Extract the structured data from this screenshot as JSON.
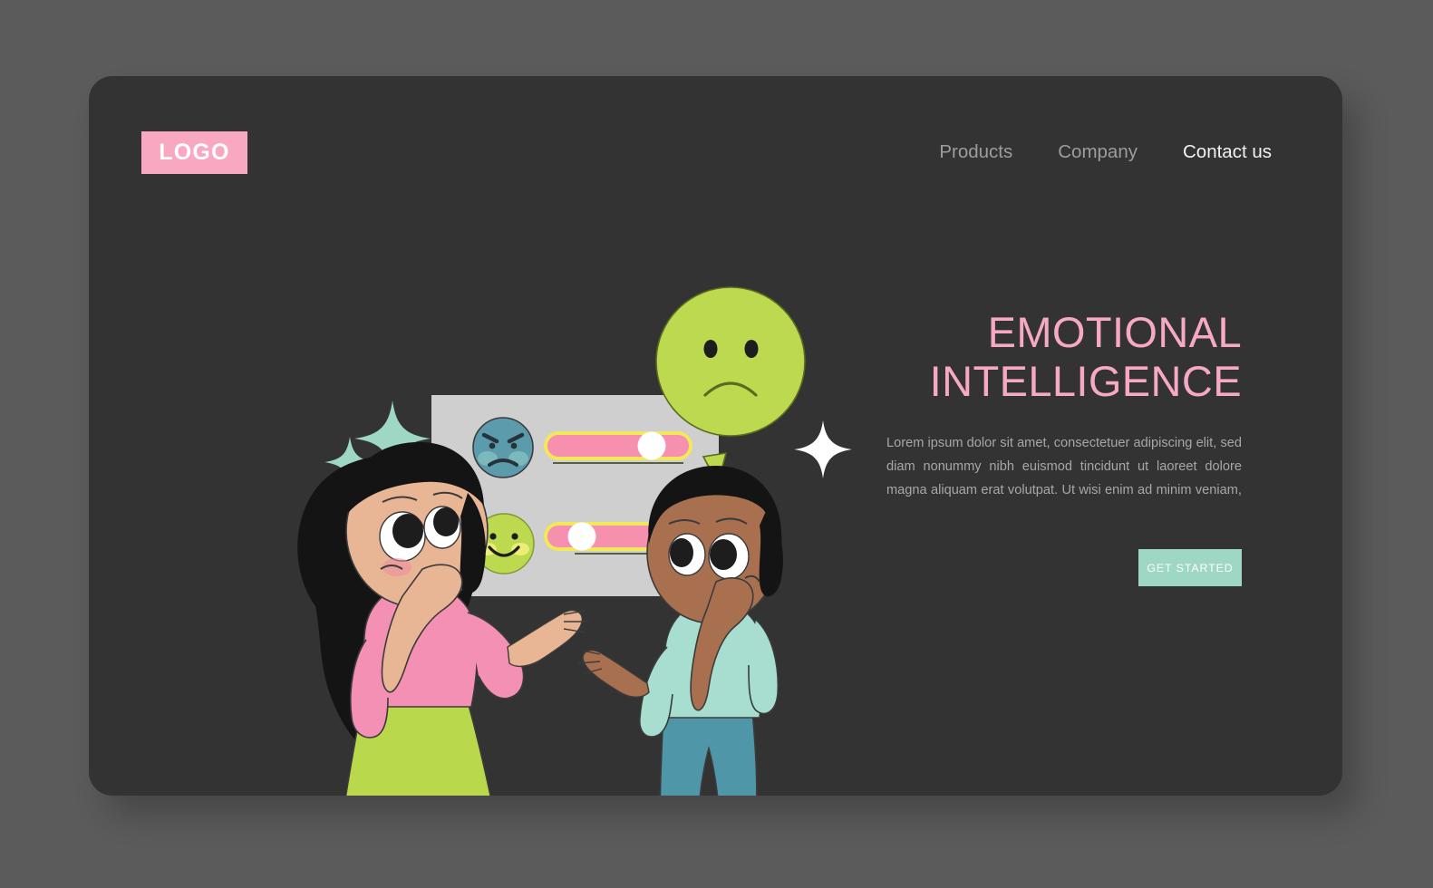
{
  "page": {
    "background_color": "#5b5b5b",
    "card_background_color": "#333333"
  },
  "header": {
    "logo": {
      "label": "LOGO",
      "background_color": "#f9a8c2",
      "text_color": "#ffffff"
    },
    "nav": [
      {
        "label": "Products",
        "active": false
      },
      {
        "label": "Company",
        "active": false
      },
      {
        "label": "Contact us",
        "active": true
      }
    ]
  },
  "hero": {
    "headline_line1": "EMOTIONAL",
    "headline_line2": "INTELLIGENCE",
    "headline_color": "#f6a8c4",
    "body": "Lorem ipsum dolor sit amet, consectetuer adipiscing elit, sed diam nonummy nibh euismod tincidunt ut laoreet dolore magna aliquam erat volutpat. Ut wisi enim ad minim veniam,",
    "body_color": "#a7a7a7",
    "cta": {
      "label": "GET STARTED",
      "background_color": "#9ed7c4",
      "text_color": "#ffffff"
    }
  },
  "illustration": {
    "speech_bubble": {
      "emotion": "sad",
      "fill_color": "#bcd94f"
    },
    "panel": {
      "background_color": "#cfcfcf",
      "rows": [
        {
          "emoji": "angry-face",
          "emoji_color": "#5b9bab",
          "slider": {
            "value_percent": 76,
            "track_color": "#f78fae",
            "outline_color": "#f2e85a",
            "knob_color": "#ffffff"
          }
        },
        {
          "emoji": "happy-face",
          "emoji_color": "#bcd94f",
          "slider": {
            "value_percent": 24,
            "track_color": "#f78fae",
            "outline_color": "#f2e85a",
            "knob_color": "#ffffff"
          }
        }
      ]
    },
    "characters": [
      {
        "name": "girl",
        "hair_color": "#141414",
        "skin_color": "#e8b595",
        "top_color": "#f590b5",
        "bottom_color": "#b9d84c",
        "pose": "hand-to-chin-thinking"
      },
      {
        "name": "boy",
        "hair_color": "#141414",
        "skin_color": "#a9704f",
        "top_color": "#a8ded0",
        "bottom_color": "#4f97a8",
        "pose": "hand-to-chin-thinking"
      }
    ],
    "sparkles": [
      {
        "color": "#9ed7c4",
        "size": "large"
      },
      {
        "color": "#9ed7c4",
        "size": "small"
      },
      {
        "color": "#ffffff",
        "size": "medium"
      }
    ]
  }
}
